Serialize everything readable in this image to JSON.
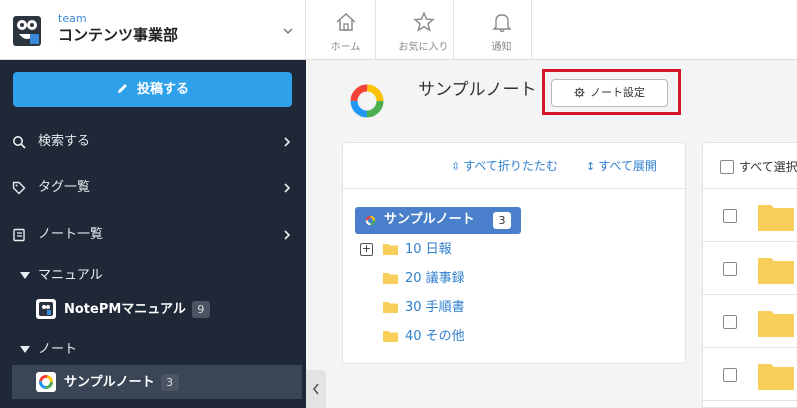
{
  "team": {
    "small_label": "team",
    "name": "コンテンツ事業部"
  },
  "nav": [
    {
      "label": "ホーム",
      "icon": "home-icon"
    },
    {
      "label": "お気に入り",
      "icon": "star-icon"
    },
    {
      "label": "通知",
      "icon": "bell-icon"
    }
  ],
  "sidebar": {
    "post_label": "投稿する",
    "items": [
      {
        "label": "検索する",
        "icon": "search-icon"
      },
      {
        "label": "タグ一覧",
        "icon": "tag-icon"
      },
      {
        "label": "ノート一覧",
        "icon": "notebook-icon"
      }
    ],
    "sections": [
      {
        "label": "マニュアル",
        "note": {
          "label": "NotePMマニュアル",
          "count": "9"
        }
      },
      {
        "label": "ノート",
        "note": {
          "label": "サンプルノート",
          "count": "3"
        }
      }
    ]
  },
  "main": {
    "note_title": "サンプルノート",
    "settings_label": "ノート設定",
    "tree_tools": {
      "collapse_all": "すべて折りたたむ",
      "expand_all": "すべて展開"
    },
    "tree_root": {
      "label": "サンプルノート",
      "count": "3"
    },
    "folders": [
      "10 日報",
      "20 議事録",
      "30 手順書",
      "40 その他"
    ],
    "list_select_all": "すべて選択"
  },
  "colors": {
    "sidebar_bg": "#1e2836",
    "accent_blue": "#2fa0ea",
    "tree_root_bg": "#4a7fcb",
    "highlight_red": "#d7182a",
    "folder_yellow": "#f8cf5a"
  }
}
